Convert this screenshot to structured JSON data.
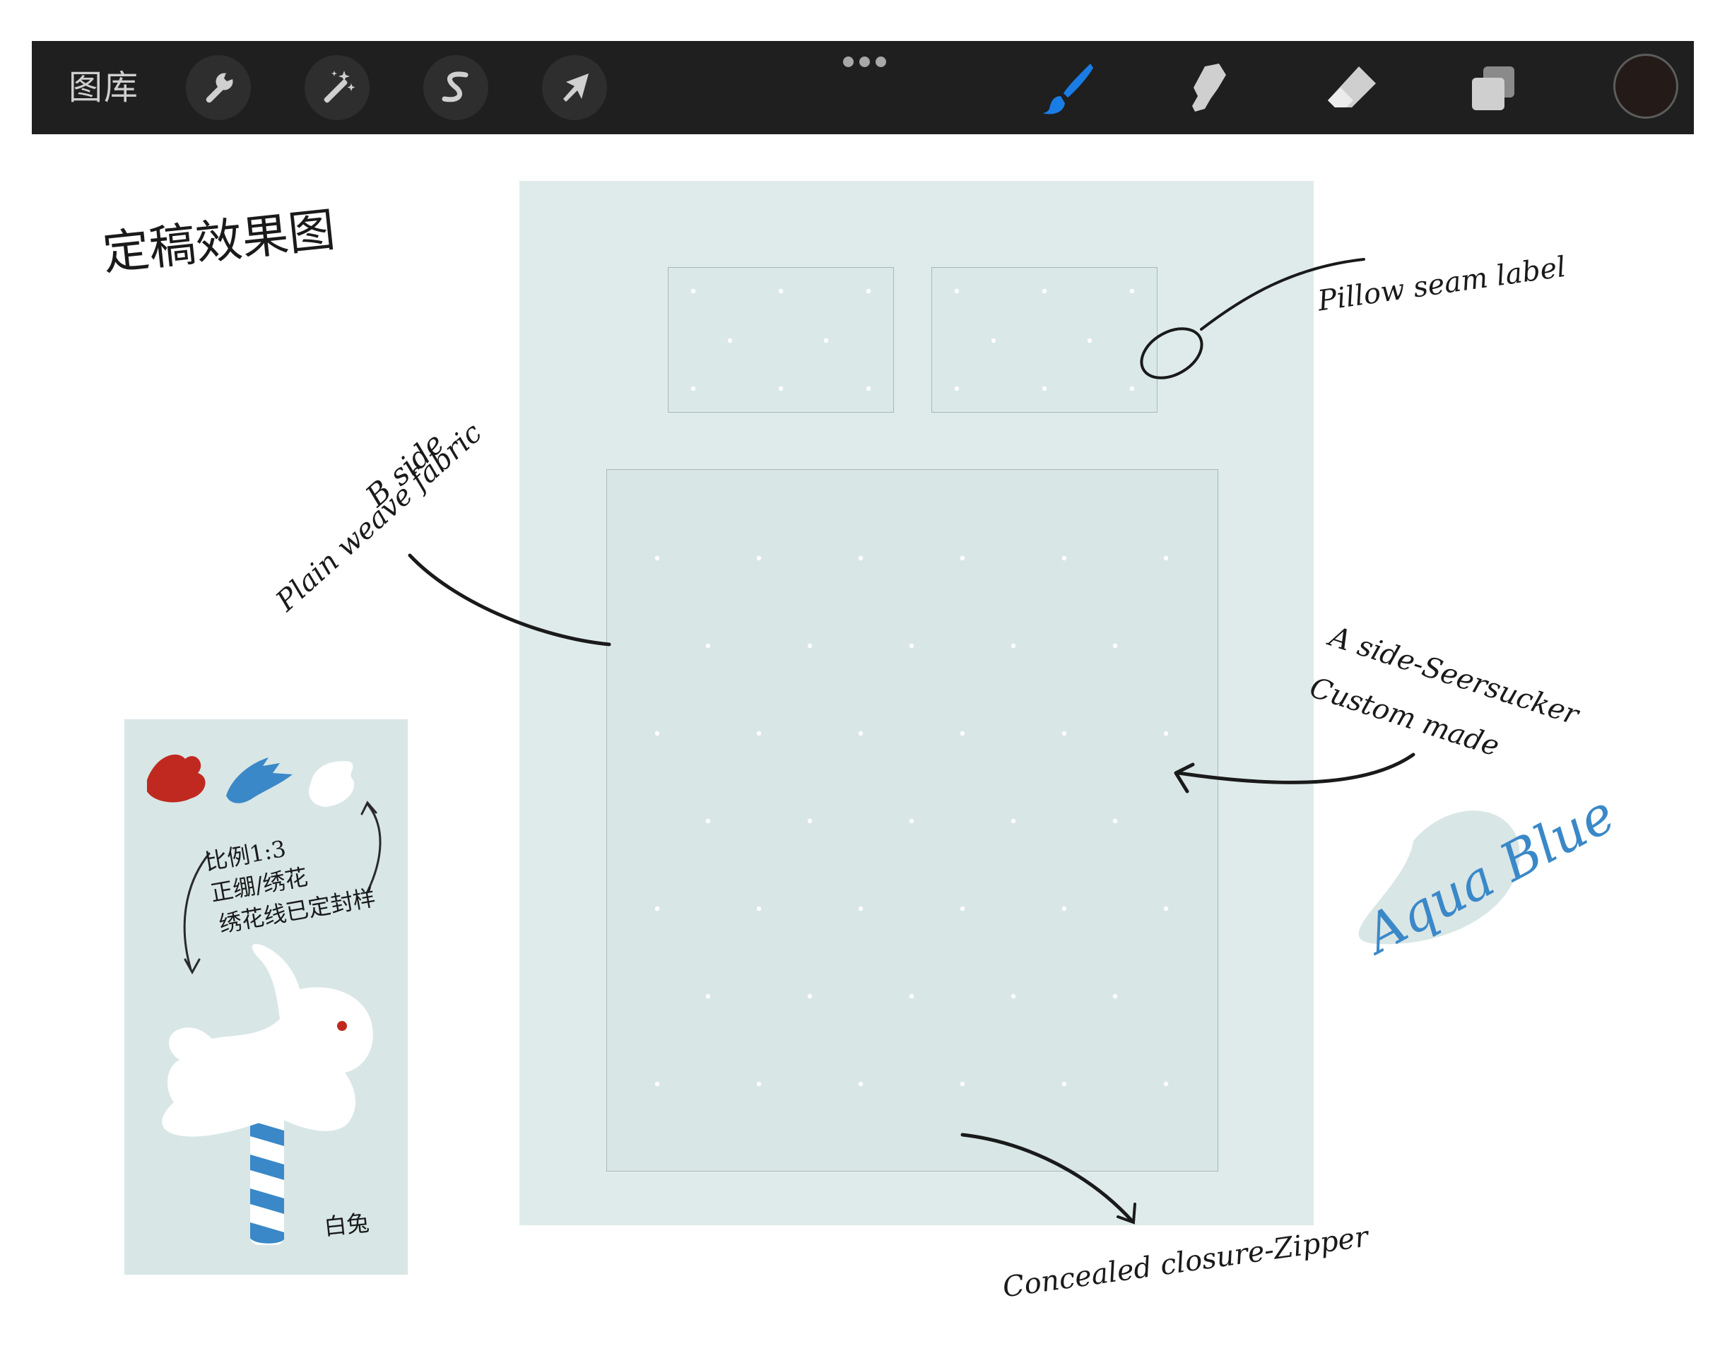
{
  "toolbar": {
    "gallery_label": "图库",
    "tools_left": [
      {
        "name": "actions",
        "icon": "wrench-icon"
      },
      {
        "name": "adjustments",
        "icon": "magic-wand-icon"
      },
      {
        "name": "selection",
        "icon": "selection-s-icon"
      },
      {
        "name": "transform",
        "icon": "arrow-cursor-icon"
      }
    ],
    "tools_right": [
      {
        "name": "brush",
        "icon": "brush-icon",
        "active": true
      },
      {
        "name": "smudge",
        "icon": "smudge-finger-icon"
      },
      {
        "name": "eraser",
        "icon": "eraser-icon"
      },
      {
        "name": "layers",
        "icon": "layers-icon"
      }
    ],
    "current_color": "#241b19",
    "active_color": "#1a7de6"
  },
  "canvas": {
    "title": "定稿效果图",
    "annotations": {
      "pillow_label": "Pillow seam label",
      "b_side_line1": "B side",
      "b_side_line2": "Plain weave fabric",
      "a_side_line1": "A side-Seersucker",
      "a_side_line2": "Custom made",
      "color_name": "Aqua Blue",
      "closure": "Concealed closure-Zipper"
    },
    "swatch_card": {
      "note_line1": "比例1:3",
      "note_line2": "正绷/绣花",
      "note_line3": "绣花线已定封样",
      "caption": "白兔",
      "colors": [
        "#c0291f",
        "#3a88c8",
        "#ffffff"
      ]
    },
    "fabric_color": "#dfebeb",
    "ink_color": "#1a1a1a",
    "accent_color": "#3a88c8"
  }
}
